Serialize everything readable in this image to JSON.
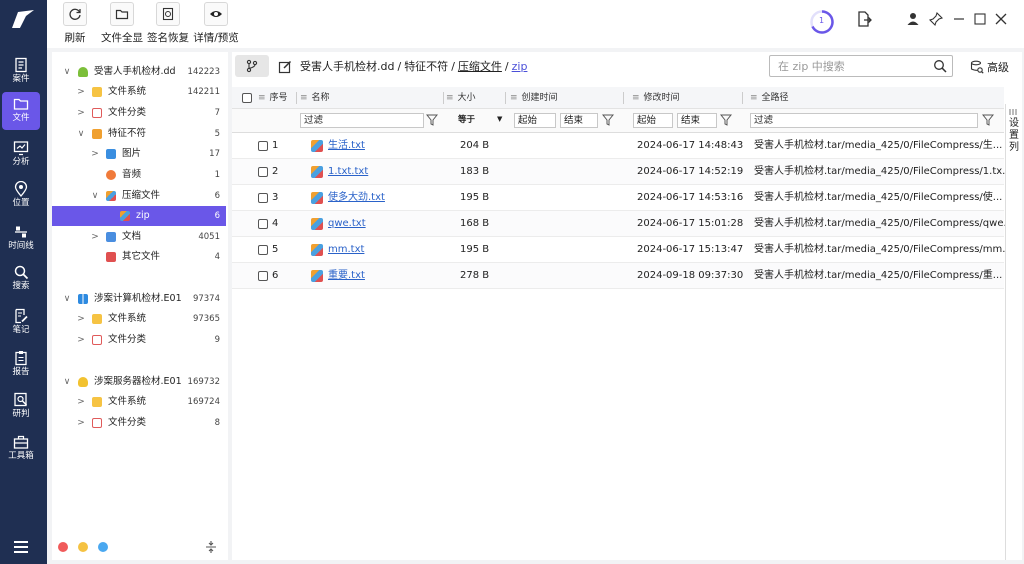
{
  "rail": {
    "items": [
      {
        "label": "案件",
        "icon": "case-file-icon"
      },
      {
        "label": "文件",
        "icon": "folder-icon",
        "active": true
      },
      {
        "label": "分析",
        "icon": "chart-monitor-icon"
      },
      {
        "label": "位置",
        "icon": "location-pin-icon"
      },
      {
        "label": "时间线",
        "icon": "timeline-icon"
      },
      {
        "label": "搜索",
        "icon": "search-icon"
      },
      {
        "label": "笔记",
        "icon": "note-edit-icon"
      },
      {
        "label": "报告",
        "icon": "report-icon"
      },
      {
        "label": "研判",
        "icon": "analysis-search-icon"
      },
      {
        "label": "工具箱",
        "icon": "toolbox-icon"
      }
    ]
  },
  "toolbar": {
    "refresh": "刷新",
    "show_all_files": "文件全显",
    "signature_recover": "签名恢复",
    "detail_preview": "详情/预览",
    "task_count": "1"
  },
  "tree": {
    "evidence": [
      {
        "label": "受害人手机检材.dd",
        "count": "142223",
        "children": [
          {
            "label": "文件系统",
            "count": "142211"
          },
          {
            "label": "文件分类",
            "count": "7"
          },
          {
            "label": "特征不符",
            "count": "5",
            "children": [
              {
                "label": "图片",
                "count": "17"
              },
              {
                "label": "音频",
                "count": "1"
              },
              {
                "label": "压缩文件",
                "count": "6",
                "children": [
                  {
                    "label": "zip",
                    "count": "6"
                  }
                ]
              },
              {
                "label": "文档",
                "count": "4051"
              },
              {
                "label": "其它文件",
                "count": "4"
              }
            ]
          }
        ]
      },
      {
        "label": "涉案计算机检材.E01",
        "count": "97374",
        "children": [
          {
            "label": "文件系统",
            "count": "97365"
          },
          {
            "label": "文件分类",
            "count": "9"
          }
        ]
      },
      {
        "label": "涉案服务器检材.E01",
        "count": "169732",
        "children": [
          {
            "label": "文件系统",
            "count": "169724"
          },
          {
            "label": "文件分类",
            "count": "8"
          }
        ]
      }
    ],
    "footer_colors": [
      "#f05a5a",
      "#f5c242",
      "#4aa8f0"
    ]
  },
  "breadcrumb": [
    "受害人手机检材.dd",
    "特征不符",
    "压缩文件",
    "zip"
  ],
  "search": {
    "placeholder": "在 zip 中搜索"
  },
  "advanced_label": "高级",
  "table": {
    "headers": {
      "index": "序号",
      "name": "名称",
      "size": "大小",
      "created": "创建时间",
      "modified": "修改时间",
      "path": "全路径"
    },
    "filters": {
      "name": "过滤",
      "size_op": "等于",
      "created_start": "起始",
      "created_end": "结束",
      "modified_start": "起始",
      "modified_end": "结束",
      "path": "过滤"
    },
    "rows": [
      {
        "index": "1",
        "name": "生活.txt",
        "size": "204 B",
        "modified": "2024-06-17 14:48:43",
        "path": "受害人手机检材.tar/media_425/0/FileCompress/生..."
      },
      {
        "index": "2",
        "name": "1.txt.txt",
        "size": "183 B",
        "modified": "2024-06-17 14:52:19",
        "path": "受害人手机检材.tar/media_425/0/FileCompress/1.tx..."
      },
      {
        "index": "3",
        "name": "使多大劲.txt",
        "size": "195 B",
        "modified": "2024-06-17 14:53:16",
        "path": "受害人手机检材.tar/media_425/0/FileCompress/使..."
      },
      {
        "index": "4",
        "name": "qwe.txt",
        "size": "168 B",
        "modified": "2024-06-17 15:01:28",
        "path": "受害人手机检材.tar/media_425/0/FileCompress/qwe..."
      },
      {
        "index": "5",
        "name": "mm.txt",
        "size": "195 B",
        "modified": "2024-06-17 15:13:47",
        "path": "受害人手机检材.tar/media_425/0/FileCompress/mm..."
      },
      {
        "index": "6",
        "name": "重要.txt",
        "size": "278 B",
        "modified": "2024-09-18 09:37:30",
        "path": "受害人手机检材.tar/media_425/0/FileCompress/重..."
      }
    ]
  },
  "side_tab": "设置列",
  "colors": {
    "rail": "#1f2f52",
    "accent": "#6a57e8",
    "link": "#2a62c9"
  }
}
